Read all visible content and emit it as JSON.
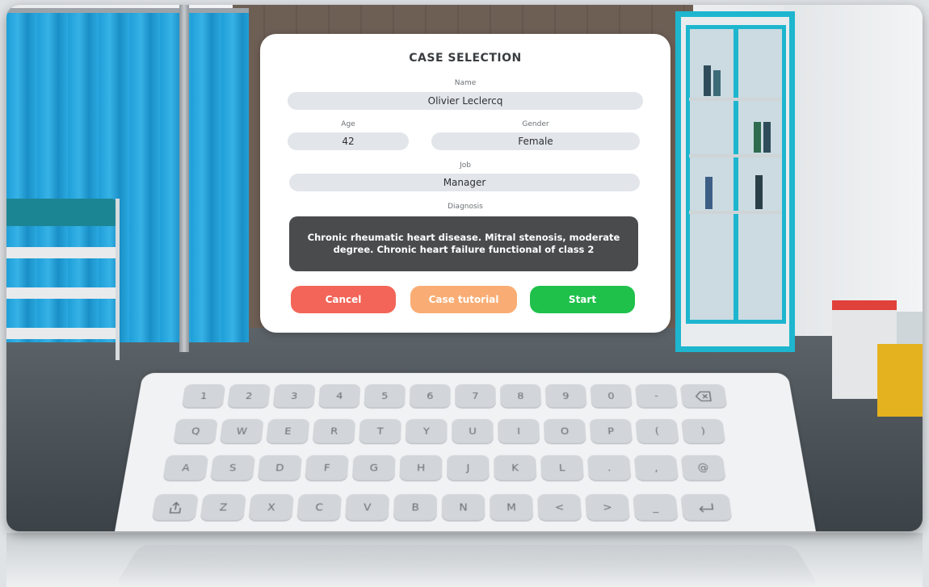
{
  "dialog": {
    "title": "CASE SELECTION",
    "name": {
      "label": "Name",
      "value": "Olivier Leclercq"
    },
    "age": {
      "label": "Age",
      "value": "42"
    },
    "gender": {
      "label": "Gender",
      "value": "Female"
    },
    "job": {
      "label": "Job",
      "value": "Manager"
    },
    "diagnosis": {
      "label": "Diagnosis",
      "value": "Chronic rheumatic heart disease. Mitral stenosis, moderate degree. Chronic heart failure functional of class 2"
    },
    "buttons": {
      "cancel": "Cancel",
      "tutorial": "Case tutorial",
      "start": "Start"
    }
  },
  "keyboard": {
    "row1": [
      "1",
      "2",
      "3",
      "4",
      "5",
      "6",
      "7",
      "8",
      "9",
      "0",
      "-"
    ],
    "row2": [
      "Q",
      "W",
      "E",
      "R",
      "T",
      "Y",
      "U",
      "I",
      "O",
      "P",
      "(",
      ")"
    ],
    "row3": [
      "A",
      "S",
      "D",
      "F",
      "G",
      "H",
      "J",
      "K",
      "L",
      ".",
      ",",
      "@"
    ],
    "row4": [
      "Z",
      "X",
      "C",
      "V",
      "B",
      "N",
      "M",
      "<",
      ">",
      "_"
    ],
    "icons": {
      "backspace": "backspace-icon",
      "share": "share-icon",
      "enter": "enter-icon"
    }
  },
  "colors": {
    "cancel": "#f26558",
    "tutorial": "#f9ad74",
    "start": "#1fc14b",
    "diagnosis_bg": "#4a4b4d",
    "field_bg": "#e2e5ea",
    "key_bg": "#d2d5d9"
  }
}
